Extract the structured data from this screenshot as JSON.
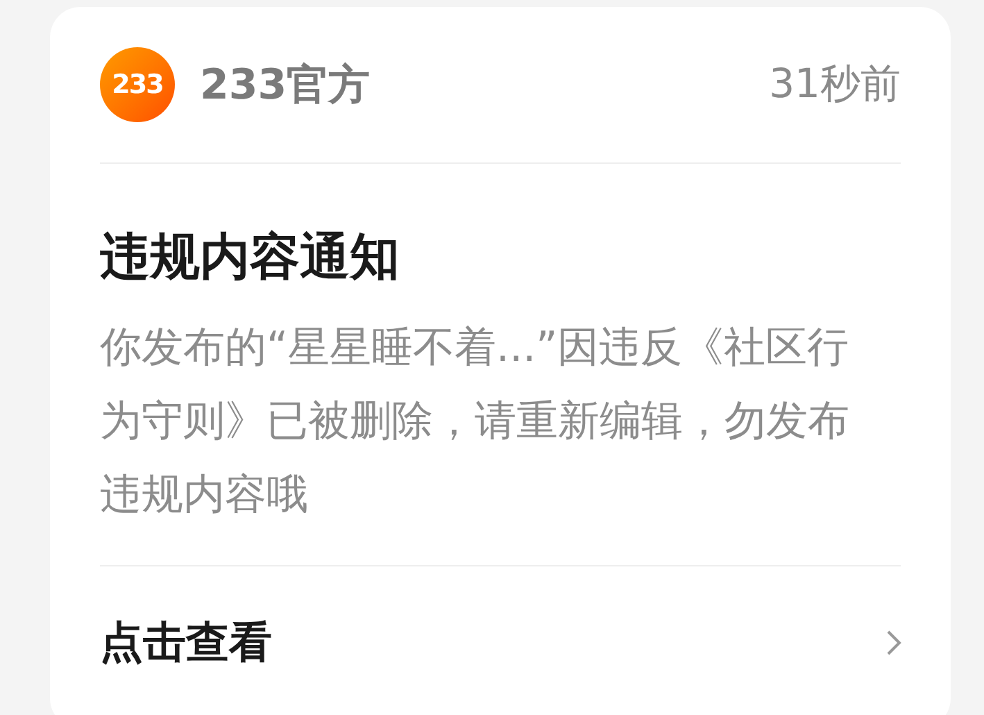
{
  "header": {
    "logo_text": "233",
    "sender": "233官方",
    "time": "31秒前"
  },
  "notice": {
    "title": "违规内容通知",
    "body": "你发布的“星星睡不着...”因违反《社区行为守则》已被删除，请重新编辑，勿发布违规内容哦"
  },
  "action": {
    "label": "点击查看"
  }
}
